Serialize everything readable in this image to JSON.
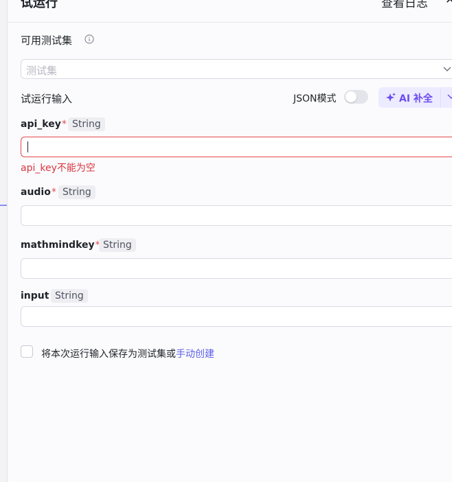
{
  "header": {
    "title": "试运行",
    "view_log": "查看日志",
    "close_glyph": "✕"
  },
  "testset": {
    "label": "可用测试集",
    "placeholder": "测试集"
  },
  "run_input": {
    "label": "试运行输入",
    "json_mode_label": "JSON模式",
    "json_mode_on": false,
    "ai_fill_label": "AI 补全"
  },
  "fields": [
    {
      "name": "api_key",
      "required": true,
      "type": "String",
      "value": "",
      "error": "api_key不能为空"
    },
    {
      "name": "audio",
      "required": true,
      "type": "String",
      "value": ""
    },
    {
      "name": "mathmindkey",
      "required": true,
      "type": "String",
      "value": ""
    },
    {
      "name": "input",
      "required": false,
      "type": "String",
      "value": ""
    }
  ],
  "save_option": {
    "text": "将本次运行输入保存为测试集或",
    "link": "手动创建",
    "checked": false
  },
  "colors": {
    "accent": "#5b5fe8",
    "ai": "#6c4cf0",
    "error": "#e5484d"
  },
  "icons": {
    "info": "info-icon",
    "chevron": "chevron-down-icon",
    "sparkle": "sparkle-icon"
  }
}
